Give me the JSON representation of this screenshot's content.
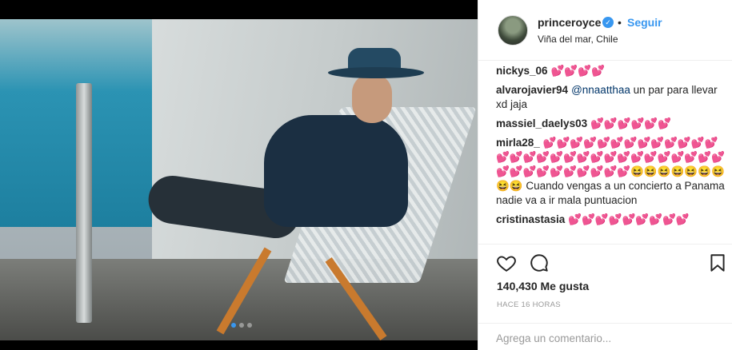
{
  "post": {
    "username": "princeroyce",
    "separator": "•",
    "follow_label": "Seguir",
    "location": "Viña del mar, Chile",
    "carousel_count": 3,
    "carousel_active": 1
  },
  "comments": [
    {
      "user": "nickys_06",
      "text": "💕💕💕💕",
      "mention": ""
    },
    {
      "user": "alvarojavier94",
      "mention": "@nnaatthaa",
      "text": " un par para llevar xd jaja"
    },
    {
      "user": "massiel_daelys03",
      "text": "💕💕💕💕💕💕",
      "mention": ""
    },
    {
      "user": "mirla28_",
      "mention": "",
      "text": "💕💕💕💕💕💕💕💕💕💕💕💕💕💕💕💕💕💕💕💕💕💕💕💕💕💕💕💕💕💕💕💕💕💕💕💕💕💕💕💕😆😆😆😆😆😆😆😆😆 Cuando vengas a un concierto a Panama nadie va a ir mala puntuacion"
    },
    {
      "user": "cristinastasia",
      "text": "💕💕💕💕💕💕💕💕💕",
      "mention": ""
    }
  ],
  "actions": {
    "likes": "140,430 Me gusta",
    "time": "HACE 16 HORAS"
  },
  "composer": {
    "placeholder": "Agrega un comentario..."
  },
  "colors": {
    "accent": "#3897f0",
    "text": "#262626",
    "muted": "#999999",
    "border": "#efefef"
  },
  "icons": [
    "verified-badge-icon",
    "heart-icon",
    "comment-icon",
    "bookmark-icon"
  ]
}
